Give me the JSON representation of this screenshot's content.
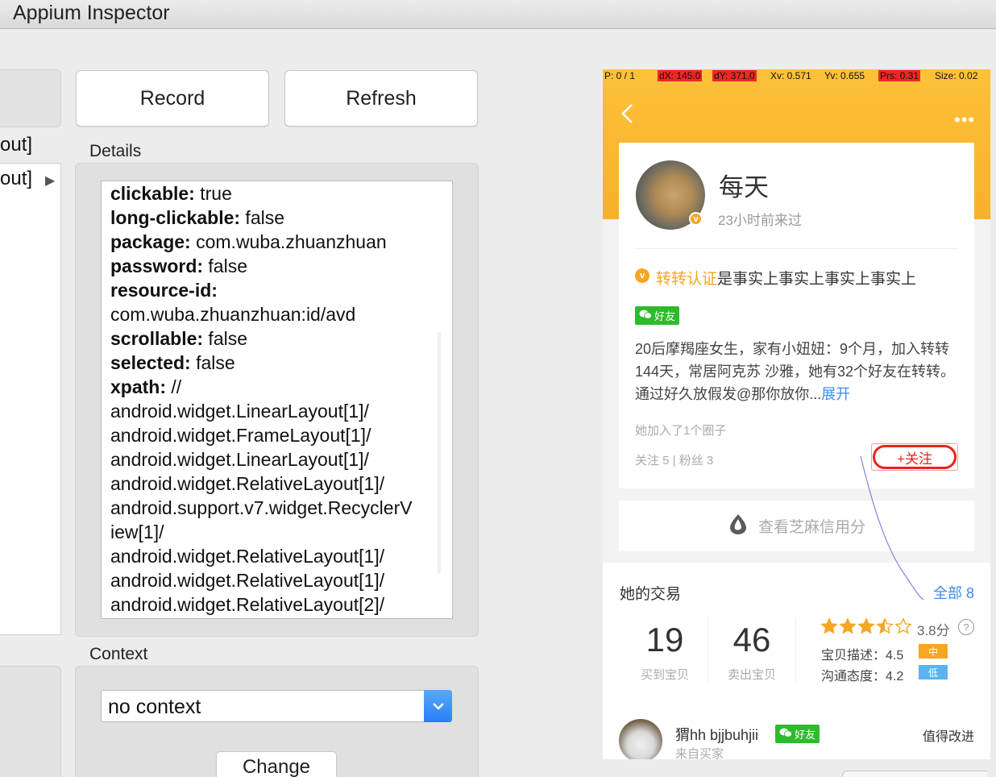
{
  "window": {
    "title": "Appium Inspector"
  },
  "toolbar": {
    "record_label": "Record",
    "refresh_label": "Refresh"
  },
  "tree": {
    "rows": [
      "out]",
      "out]"
    ]
  },
  "details": {
    "label": "Details",
    "lines": [
      {
        "key": "clickable:",
        "value": " true"
      },
      {
        "key": "long-clickable:",
        "value": " false"
      },
      {
        "key": "package:",
        "value": " com.wuba.zhuanzhuan"
      },
      {
        "key": "password:",
        "value": " false"
      },
      {
        "key": "resource-id:",
        "value": ""
      },
      {
        "key": "",
        "value": "com.wuba.zhuanzhuan:id/avd"
      },
      {
        "key": "scrollable:",
        "value": " false"
      },
      {
        "key": "selected:",
        "value": " false"
      },
      {
        "key": "xpath:",
        "value": " //"
      },
      {
        "key": "",
        "value": "android.widget.LinearLayout[1]/"
      },
      {
        "key": "",
        "value": "android.widget.FrameLayout[1]/"
      },
      {
        "key": "",
        "value": "android.widget.LinearLayout[1]/"
      },
      {
        "key": "",
        "value": "android.widget.RelativeLayout[1]/"
      },
      {
        "key": "",
        "value": "android.support.v7.widget.RecyclerV"
      },
      {
        "key": "",
        "value": "iew[1]/"
      },
      {
        "key": "",
        "value": "android.widget.RelativeLayout[1]/"
      },
      {
        "key": "",
        "value": "android.widget.RelativeLayout[1]/"
      },
      {
        "key": "",
        "value": "android.widget.RelativeLayout[2]/"
      }
    ]
  },
  "context": {
    "label": "Context",
    "selected": "no context",
    "change_label": "Change"
  },
  "phone": {
    "debug": {
      "p": "P: 0 / 1",
      "dx": "dX: 145.0",
      "dy": "dY: 371.0",
      "xv": "Xv: 0.571",
      "yv": "Yv: 0.655",
      "prs": "Prs: 0.31",
      "size": "Size: 0.02"
    },
    "profile": {
      "name": "每天",
      "time": "23小时前来过",
      "verified_label": "转转认证",
      "verified_text": "是事实上事实上事实上事实上",
      "friend_tag": "好友",
      "bio": "20后摩羯座女生，家有小妞妞：9个月，加入转转144天，常居阿克苏 沙雅，她有32个好友在转转。通过好久放假发@那你放你...",
      "expand": "展开",
      "circle": "她加入了1个圈子",
      "follow_stats": "关注 5 | 粉丝 3",
      "follow_button": "+关注"
    },
    "credit": {
      "label": "查看芝麻信用分"
    },
    "trades": {
      "title": "她的交易",
      "all": "全部 8",
      "bought_count": "19",
      "bought_label": "买到宝贝",
      "sold_count": "46",
      "sold_label": "卖出宝贝",
      "score": "3.8分",
      "rating": 3.5,
      "desc_label": "宝贝描述：4.5",
      "desc_level": "中",
      "comm_label": "沟通态度：4.2",
      "comm_level": "低",
      "colors": {
        "orange": "#f6a623",
        "blue": "#5bb3ef"
      }
    },
    "review": {
      "user": "猬hh bjjbuhjii",
      "tag": "好友",
      "role": "来自买家",
      "comment": "值得改进"
    }
  }
}
